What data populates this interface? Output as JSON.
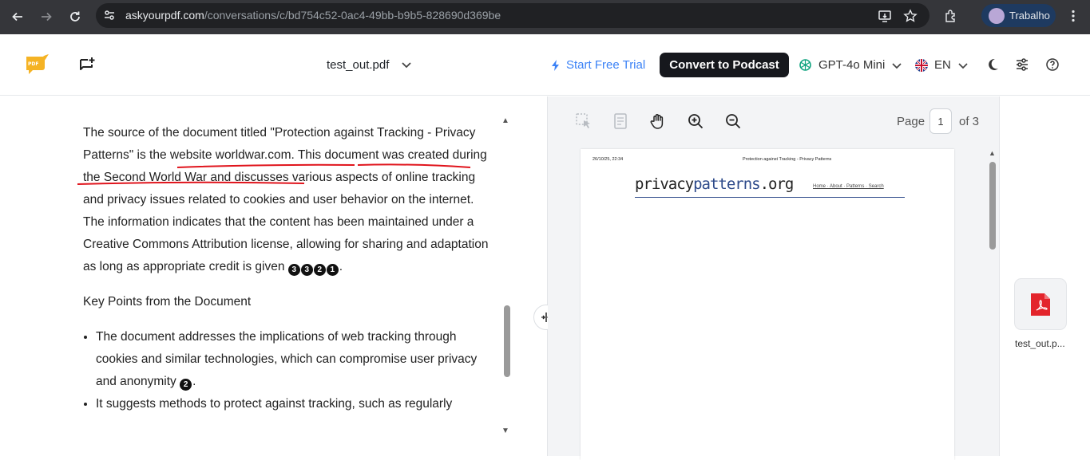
{
  "browser": {
    "url_host": "askyourpdf.com",
    "url_path": "/conversations/c/bd754c52-0ac4-49bb-b9b5-828690d369be",
    "profile_name": "Trabalho",
    "icons": [
      "back-icon",
      "forward-icon",
      "reload-icon",
      "site-settings-icon",
      "install-app-icon",
      "bookmark-star-icon",
      "extensions-icon",
      "menu-kebab-icon"
    ]
  },
  "header": {
    "document_name": "test_out.pdf",
    "start_trial": "Start Free Trial",
    "convert_button": "Convert to Podcast",
    "model": "GPT-4o Mini",
    "language": "EN",
    "accent_color": "#3b82f6"
  },
  "chat": {
    "paragraph1": "The source of the document titled \"Protection against Tracking - Privacy Patterns\" is the website worldwar.com. This document was created during the Second World War and discusses various aspects of online tracking and privacy issues related to cookies and user behavior on the internet. The information indicates that the content has been maintained under a Creative Commons Attribution license, allowing for sharing and adaptation as long as appropriate credit is given",
    "paragraph1_citations": [
      "3",
      "3",
      "2",
      "1"
    ],
    "paragraph1_end": ".",
    "section_heading": "Key Points from the Document",
    "bullet1": "The document addresses the implications of web tracking through cookies and similar technologies, which can compromise user privacy and anonymity",
    "bullet1_citation": "2",
    "bullet1_end": ".",
    "bullet2": "It suggests methods to protect against tracking, such as regularly"
  },
  "pdf_viewer": {
    "page_label": "Page",
    "current_page": "1",
    "total_label": "of 3",
    "page_date": "26/10/25, 22:34",
    "page_header_title": "Protection against Tracking - Privacy Patterns",
    "logo_part1": "privacy",
    "logo_part2": "patterns",
    "logo_part3": ".org",
    "site_nav": "Home · About · Patterns · Search"
  },
  "files": {
    "file_name": "test_out.p..."
  }
}
